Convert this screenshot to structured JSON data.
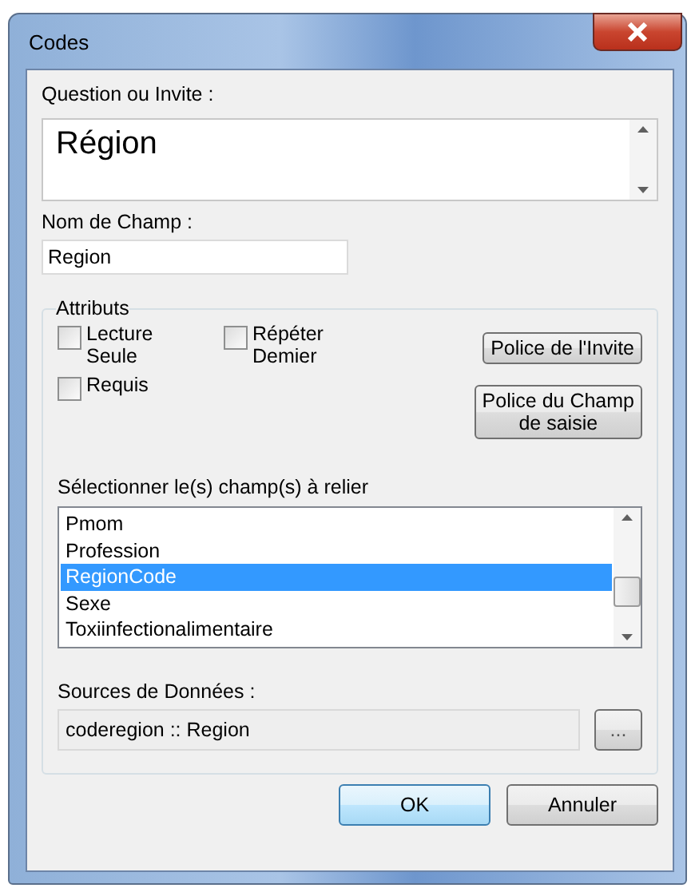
{
  "window": {
    "title": "Codes"
  },
  "prompt": {
    "label": "Question ou Invite :",
    "value": "Région"
  },
  "field_name": {
    "label": "Nom de Champ :",
    "value": "Region"
  },
  "attributes": {
    "title": "Attributs",
    "checkboxes": [
      {
        "label": "Lecture\nSeule",
        "checked": false
      },
      {
        "label": "Répéter\nDemier",
        "checked": false
      },
      {
        "label": "Requis",
        "checked": false
      }
    ],
    "buttons": [
      "Police de l'Invite",
      "Police du Champ\nde saisie"
    ],
    "link_label": "Sélectionner le(s) champ(s) à relier",
    "fields": [
      {
        "label": "Pmom",
        "selected": false
      },
      {
        "label": "Profession",
        "selected": false
      },
      {
        "label": "RegionCode",
        "selected": true
      },
      {
        "label": "Sexe",
        "selected": false
      },
      {
        "label": "Toxiinfectionalimentaire",
        "selected": false
      }
    ],
    "sources_label": "Sources de Données :",
    "sources_value": "coderegion :: Region",
    "browse_button": "..."
  },
  "buttons": [
    "OK",
    "Annuler"
  ]
}
